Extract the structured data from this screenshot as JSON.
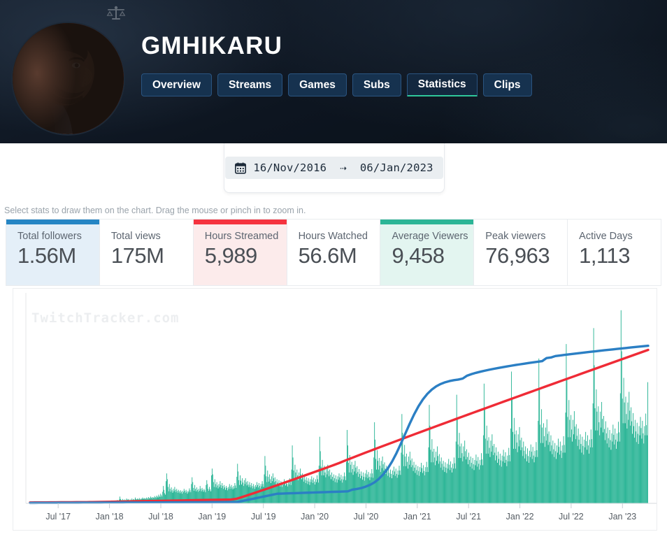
{
  "header": {
    "scales_icon": "scales-icon",
    "profile_name": "GMHIKARU",
    "tabs": [
      {
        "label": "Overview",
        "active": false
      },
      {
        "label": "Streams",
        "active": false
      },
      {
        "label": "Games",
        "active": false
      },
      {
        "label": "Subs",
        "active": false
      },
      {
        "label": "Statistics",
        "active": true
      },
      {
        "label": "Clips",
        "active": false
      }
    ],
    "accent_active": "#2fc79a",
    "avatar": "avatar"
  },
  "daterange": {
    "icon": "calendar-icon",
    "start": "16/Nov/2016",
    "arrow": "⇢",
    "end": "06/Jan/2023",
    "text": "16/Nov/2016  ⇢  06/Jan/2023"
  },
  "hint": "Select stats to draw them on the chart. Drag the mouse or pinch in to zoom in.",
  "stats": [
    {
      "label": "Total followers",
      "value": "1.56M",
      "selected": true,
      "accent": "#2585c4",
      "bg": "#e4eff8"
    },
    {
      "label": "Total views",
      "value": "175M",
      "selected": false,
      "accent": "",
      "bg": "#ffffff"
    },
    {
      "label": "Hours Streamed",
      "value": "5,989",
      "selected": true,
      "accent": "#f5333f",
      "bg": "#fcebeb"
    },
    {
      "label": "Hours Watched",
      "value": "56.6M",
      "selected": false,
      "accent": "",
      "bg": "#ffffff"
    },
    {
      "label": "Average Viewers",
      "value": "9,458",
      "selected": true,
      "accent": "#2bb596",
      "bg": "#e3f5f0"
    },
    {
      "label": "Peak viewers",
      "value": "76,963",
      "selected": false,
      "accent": "",
      "bg": "#ffffff"
    },
    {
      "label": "Active Days",
      "value": "1,113",
      "selected": false,
      "accent": "",
      "bg": "#ffffff"
    }
  ],
  "chart_watermark": "TwitchTracker.com",
  "chart_data": {
    "type": "bar",
    "title": "",
    "xlabel": "",
    "ylabel": "",
    "grid": false,
    "legend": "none",
    "x_tick_labels": [
      "Jul '17",
      "Jan '18",
      "Jul '18",
      "Jan '19",
      "Jul '19",
      "Jan '20",
      "Jul '20",
      "Jan '21",
      "Jul '21",
      "Jan '22",
      "Jul '22",
      "Jan '23"
    ],
    "x_range": [
      "16/Nov/2016",
      "06/Jan/2023"
    ],
    "series": [
      {
        "name": "Average Viewers",
        "type": "bar",
        "color": "#2bb596",
        "values": [
          0,
          0,
          0,
          0,
          0,
          0,
          0,
          0,
          0,
          0,
          0,
          0,
          1,
          0,
          1,
          0,
          0,
          1,
          0,
          0,
          1,
          1,
          0,
          0,
          0,
          1,
          0,
          0,
          1,
          0,
          0,
          0,
          0,
          1,
          1,
          0,
          1,
          0,
          0,
          1,
          2,
          1,
          1,
          0,
          1,
          1,
          0,
          1,
          1,
          0,
          2,
          1,
          1,
          0,
          1,
          1,
          2,
          1,
          1,
          0,
          1,
          2,
          1,
          1,
          1,
          1,
          2,
          1,
          1,
          2,
          1,
          1,
          2,
          2,
          1,
          2,
          1,
          2,
          2,
          1,
          2,
          1,
          2,
          2,
          3,
          2,
          2,
          3,
          2,
          2,
          3,
          2,
          3,
          2,
          3,
          3,
          2,
          3,
          3,
          2,
          3,
          3,
          4,
          3,
          3,
          4,
          3,
          4,
          3,
          4,
          4,
          3,
          4,
          4,
          5,
          4,
          4,
          5,
          4,
          5,
          5,
          4,
          6,
          5,
          5,
          6,
          5,
          6,
          6,
          5,
          7,
          6,
          6,
          8,
          14,
          9,
          7,
          6,
          9,
          7,
          6,
          8,
          7,
          6,
          10,
          8,
          7,
          9,
          7,
          6,
          8,
          7,
          10,
          7,
          8,
          9,
          7,
          12,
          9,
          8,
          10,
          9,
          8,
          11,
          9,
          8,
          10,
          9,
          12,
          10,
          9,
          11,
          10,
          9,
          12,
          11,
          9,
          13,
          11,
          10,
          14,
          12,
          10,
          13,
          12,
          11,
          15,
          13,
          11,
          16,
          14,
          12,
          18,
          15,
          13,
          20,
          17,
          14,
          24,
          36,
          28,
          21,
          18,
          46,
          62,
          50,
          34,
          25,
          40,
          30,
          24,
          33,
          27,
          22,
          30,
          25,
          34,
          28,
          23,
          30,
          26,
          22,
          28,
          25,
          21,
          27,
          24,
          20,
          26,
          23,
          30,
          26,
          22,
          28,
          24,
          20,
          26,
          23,
          31,
          27,
          23,
          40,
          54,
          44,
          32,
          26,
          38,
          30,
          25,
          33,
          28,
          24,
          30,
          26,
          36,
          30,
          25,
          32,
          28,
          24,
          30,
          27,
          23,
          38,
          48,
          40,
          30,
          26,
          34,
          29,
          25,
          58,
          72,
          60,
          44,
          34,
          50,
          40,
          33,
          44,
          37,
          31,
          40,
          34,
          46,
          38,
          32,
          42,
          36,
          30,
          38,
          33,
          28,
          36,
          32,
          27,
          34,
          30,
          40,
          35,
          30,
          38,
          33,
          29,
          36,
          31,
          42,
          37,
          32,
          55,
          82,
          66,
          48,
          38,
          58,
          47,
          39,
          52,
          43,
          36,
          48,
          40,
          52,
          44,
          37,
          46,
          39,
          34,
          44,
          38,
          33,
          42,
          36,
          31,
          40,
          35,
          30,
          38,
          34,
          44,
          38,
          33,
          42,
          36,
          31,
          40,
          35,
          46,
          40,
          34,
          60,
          98,
          78,
          56,
          44,
          68,
          55,
          45,
          60,
          50,
          42,
          56,
          46,
          62,
          52,
          44,
          54,
          46,
          39,
          50,
          43,
          37,
          48,
          41,
          35,
          46,
          40,
          34,
          44,
          39,
          50,
          43,
          37,
          47,
          40,
          35,
          45,
          39,
          52,
          45,
          38,
          70,
          120,
          95,
          68,
          52,
          80,
          64,
          52,
          70,
          58,
          48,
          64,
          54,
          72,
          60,
          50,
          62,
          53,
          45,
          58,
          49,
          42,
          54,
          47,
          40,
          52,
          45,
          38,
          50,
          44,
          56,
          49,
          42,
          53,
          45,
          39,
          50,
          44,
          58,
          50,
          43,
          78,
          138,
          108,
          76,
          58,
          90,
          72,
          58,
          78,
          64,
          54,
          72,
          60,
          80,
          67,
          56,
          70,
          59,
          50,
          64,
          55,
          47,
          60,
          52,
          44,
          58,
          50,
          43,
          56,
          49,
          62,
          54,
          47,
          59,
          50,
          43,
          56,
          49,
          64,
          56,
          48,
          86,
          152,
          120,
          84,
          64,
          100,
          80,
          64,
          86,
          71,
          59,
          80,
          66,
          88,
          74,
          62,
          77,
          65,
          55,
          71,
          61,
          52,
          66,
          57,
          49,
          64,
          55,
          47,
          62,
          54,
          69,
          60,
          52,
          65,
          55,
          48,
          62,
          54,
          71,
          62,
          53,
          95,
          168,
          132,
          92,
          70,
          110,
          88,
          70,
          94,
          78,
          65,
          88,
          73,
          97,
          81,
          68,
          85,
          72,
          61,
          78,
          67,
          57,
          73,
          63,
          54,
          70,
          61,
          52,
          68,
          59,
          76,
          66,
          57,
          72,
          61,
          53,
          68,
          59,
          78,
          68,
          59,
          105,
          185,
          146,
          101,
          77,
          121,
          97,
          77,
          103,
          86,
          72,
          97,
          80,
          107,
          89,
          75,
          93,
          79,
          67,
          86,
          74,
          63,
          80,
          69,
          59,
          77,
          67,
          57,
          75,
          65,
          84,
          73,
          63,
          79,
          67,
          58,
          75,
          65,
          86,
          75,
          65,
          116,
          204,
          161,
          111,
          85,
          133,
          107,
          85,
          113,
          95,
          79,
          107,
          88,
          118,
          98,
          82,
          102,
          87,
          74,
          95,
          82,
          69,
          88,
          76,
          65,
          85,
          74,
          63,
          82,
          72,
          92,
          80,
          69,
          87,
          74,
          64,
          82,
          72,
          95,
          83,
          72,
          128,
          225,
          177,
          122,
          94,
          146,
          118,
          94,
          124,
          104,
          87,
          118,
          97,
          130,
          108,
          91,
          112,
          96,
          81,
          105,
          90,
          76,
          97,
          84,
          72,
          94,
          81,
          69,
          90,
          79,
          101,
          88,
          76,
          96,
          82,
          70,
          90,
          79,
          104,
          91,
          79,
          141,
          248,
          195,
          134,
          103,
          161,
          130,
          103,
          137,
          115,
          96,
          130,
          107,
          143,
          119,
          100,
          123,
          105,
          89,
          116,
          99,
          84,
          107,
          92,
          79,
          103,
          89,
          76,
          99,
          87,
          111,
          97,
          84,
          106,
          90,
          77,
          99,
          87,
          115,
          100,
          87,
          155,
          273,
          215,
          148,
          113,
          177,
          143,
          113,
          151,
          126,
          106,
          143,
          118,
          158,
          131,
          110,
          136,
          116,
          98,
          128,
          109,
          93,
          118,
          102,
          87,
          114,
          98,
          84,
          109,
          96,
          122,
          107,
          92,
          117,
          99,
          85,
          109,
          96,
          127,
          110,
          96,
          171,
          300,
          236,
          163,
          125,
          195,
          157,
          125,
          166,
          139,
          117,
          157,
          130,
          174,
          144,
          121,
          149,
          127,
          108,
          141,
          120,
          102,
          130,
          112,
          96,
          125,
          108,
          92,
          120,
          105,
          134,
          117,
          101,
          128,
          109,
          94,
          120,
          105,
          139,
          121,
          105,
          188,
          330,
          260,
          179,
          137,
          214,
          173,
          137,
          183,
          153,
          128,
          173,
          143,
          191,
          159,
          133,
          164,
          140,
          119,
          155,
          132,
          112,
          143,
          123,
          105,
          138,
          119,
          101,
          132,
          116,
          148,
          129,
          111,
          141,
          120,
          103,
          132,
          116,
          153,
          133,
          116,
          207,
          363,
          286,
          197,
          151,
          236,
          190,
          151,
          201,
          168,
          141,
          190,
          157,
          210,
          175,
          147,
          181,
          154,
          131,
          170,
          145,
          124,
          157,
          135,
          116,
          152,
          131,
          111,
          145,
          128,
          163,
          142,
          122,
          155,
          132,
          113,
          145,
          128,
          169,
          147,
          128,
          228,
          400,
          315,
          217,
          166,
          260,
          209,
          166,
          221,
          185,
          155,
          209,
          173,
          231,
          192,
          161,
          199,
          170,
          144,
          187,
          160,
          136,
          173,
          149,
          127,
          167,
          144,
          123,
          160,
          141,
          179,
          156,
          134,
          171,
          145,
          124,
          160,
          141,
          186,
          162,
          141,
          251
        ],
        "note": "daily average viewers; tall spikes in Jan 2021 peak"
      },
      {
        "name": "Total followers",
        "type": "line",
        "color": "#2b7fc4",
        "shape": "cumulative S-curve, flat until early 2019, steep rise Apr 2020 - Jan 2021, then gradual saturation to 1.56M",
        "final_value": "1.56M"
      },
      {
        "name": "Hours Streamed",
        "type": "line",
        "color": "#ef2b36",
        "shape": "cumulative near-linear growth from 2017, steepening after 2019, reaching 5,989 total hours",
        "final_value": "5,989"
      }
    ]
  }
}
